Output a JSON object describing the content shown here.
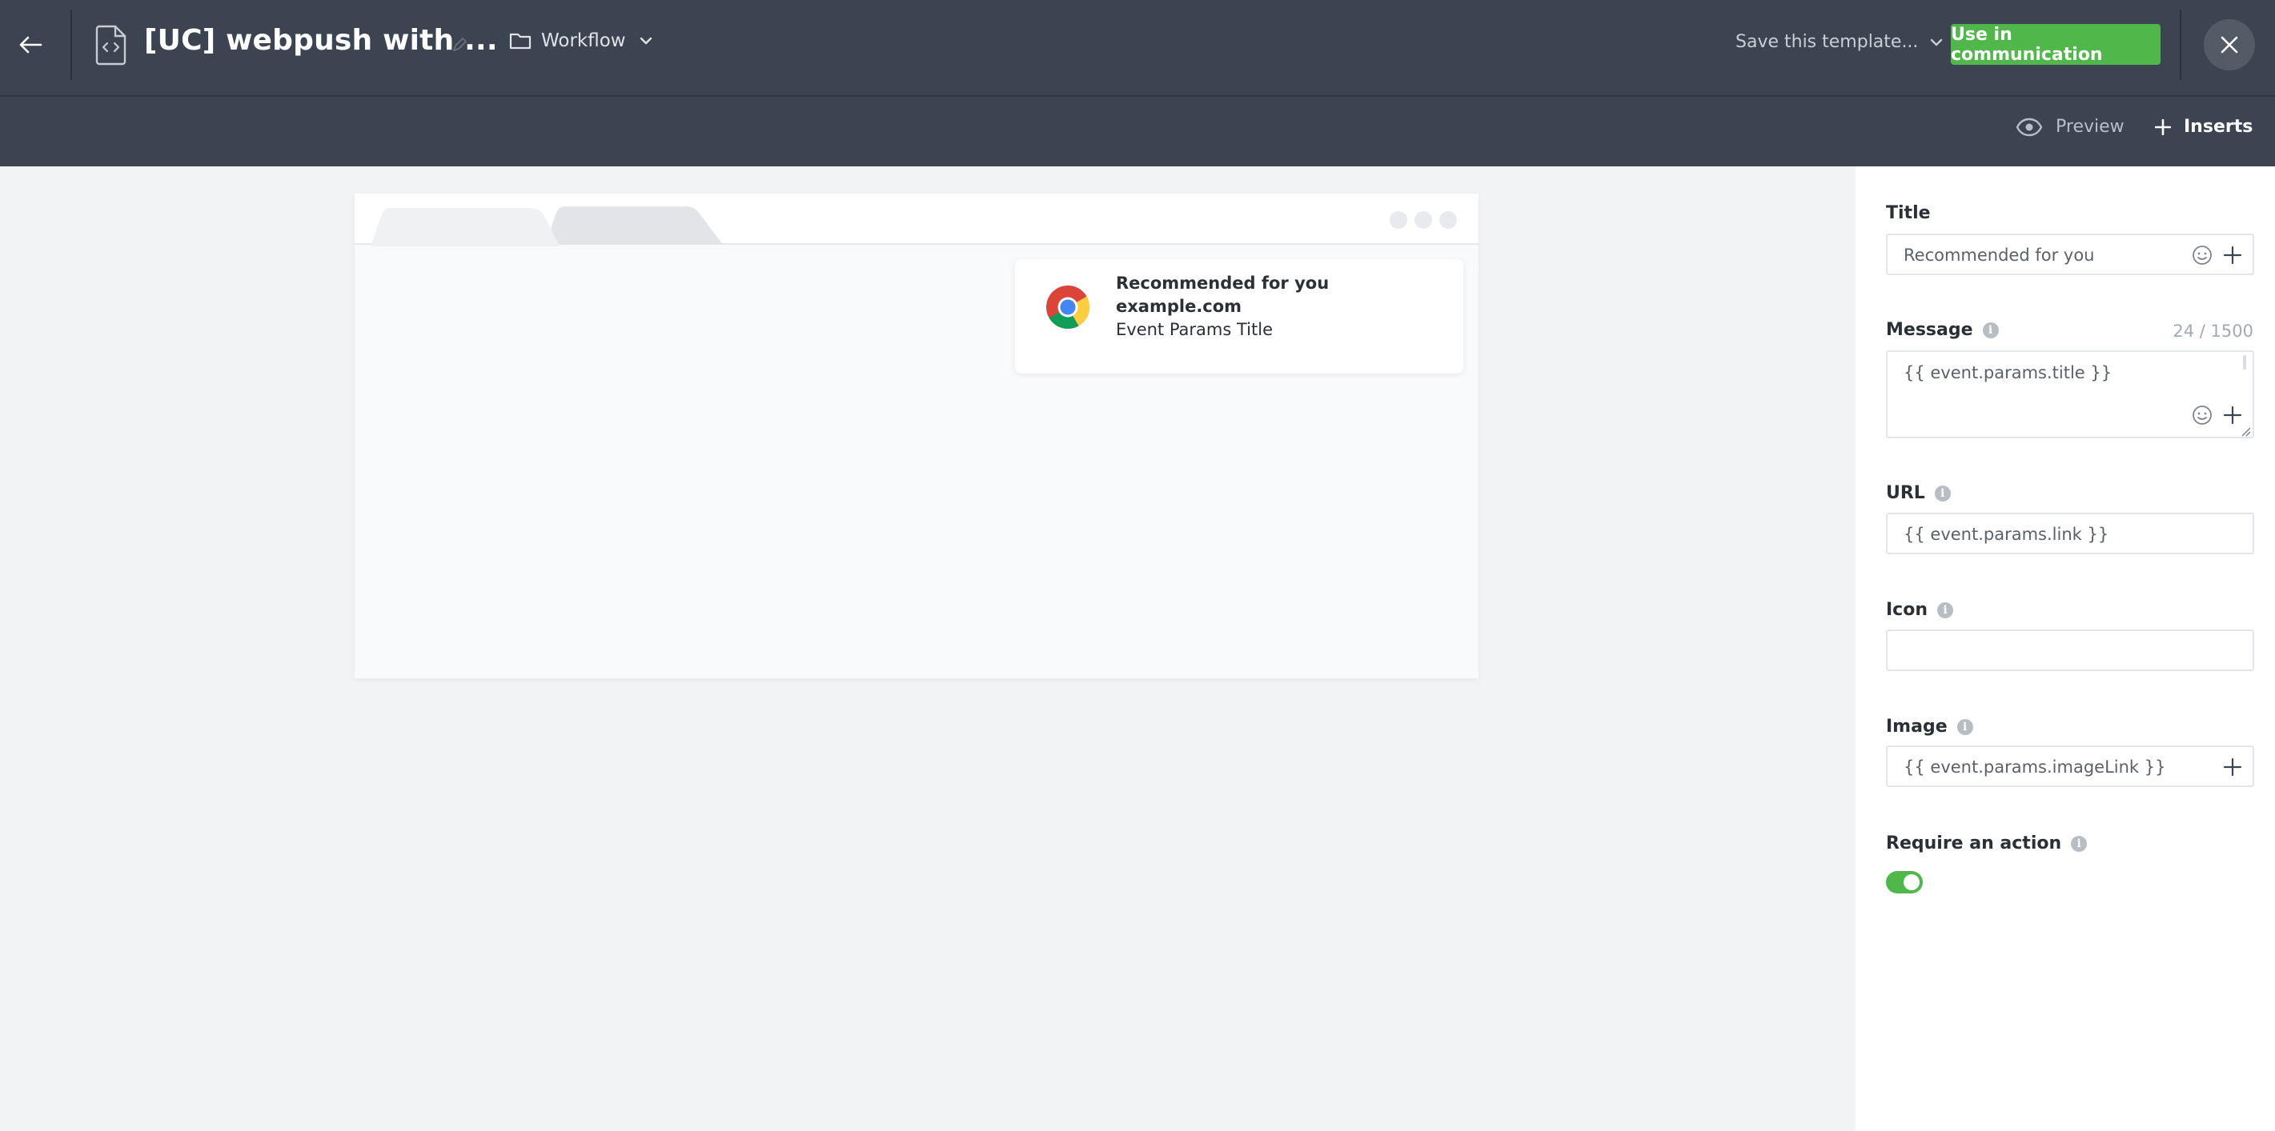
{
  "header": {
    "title": "[UC] webpush with ...",
    "folder_label": "Workflow",
    "save_template_label": "Save this template...",
    "use_button_label": "Use in communication"
  },
  "subbar": {
    "preview_label": "Preview",
    "inserts_label": "Inserts"
  },
  "notification": {
    "title": "Recommended for you",
    "site": "example.com",
    "body": "Event Params Title"
  },
  "form": {
    "title_label": "Title",
    "title_value": "Recommended for you",
    "message_label": "Message",
    "message_counter": "24 / 1500",
    "message_value": "{{ event.params.title }}",
    "url_label": "URL",
    "url_value": "{{ event.params.link }}",
    "icon_label": "Icon",
    "icon_value": "",
    "image_label": "Image",
    "image_value": "{{ event.params.imageLink }}",
    "require_action_label": "Require an action",
    "require_action_on": true
  },
  "colors": {
    "header_bg": "#3d4451",
    "accent_green": "#50b84a",
    "canvas_bg": "#f2f3f5"
  },
  "icons": [
    "back-arrow-icon",
    "document-code-icon",
    "pencil-icon",
    "folder-icon",
    "chevron-down-icon",
    "close-icon",
    "eye-icon",
    "plus-icon",
    "chrome-icon",
    "emoji-icon",
    "info-icon"
  ]
}
